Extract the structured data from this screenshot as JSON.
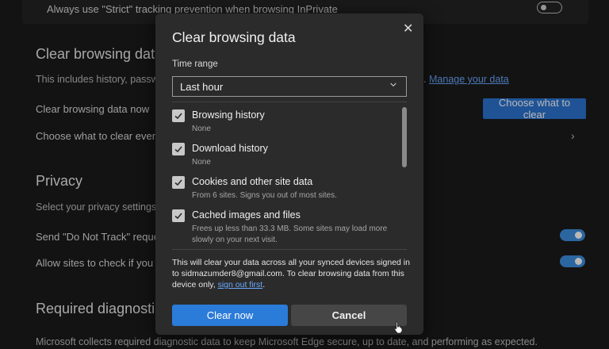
{
  "background": {
    "strict_toggle_text": "Always use \"Strict\" tracking prevention when browsing InPrivate",
    "clear_section_title": "Clear browsing data",
    "clear_section_desc": "This includes history, passwo",
    "manage_link_dot": ".",
    "manage_link": "Manage your data",
    "clear_now_row": "Clear browsing data now",
    "choose_button": "Choose what to clear",
    "choose_every_row": "Choose what to clear every t",
    "privacy_title": "Privacy",
    "privacy_desc": "Select your privacy settings fo",
    "dnt_row": "Send \"Do Not Track\" reques",
    "allow_sites_row": "Allow sites to check if you ha",
    "required_diag_title": "Required diagnostic",
    "footer_text": "Microsoft collects required diagnostic data to keep Microsoft Edge secure, up to date, and performing as expected."
  },
  "dialog": {
    "title": "Clear browsing data",
    "close_icon": "close-icon",
    "time_range_label": "Time range",
    "time_range_value": "Last hour",
    "items": [
      {
        "label": "Browsing history",
        "desc": "None",
        "checked": true
      },
      {
        "label": "Download history",
        "desc": "None",
        "checked": true
      },
      {
        "label": "Cookies and other site data",
        "desc": "From 6 sites. Signs you out of most sites.",
        "checked": true
      },
      {
        "label": "Cached images and files",
        "desc": "Frees up less than 33.3 MB. Some sites may load more slowly on your next visit.",
        "checked": true
      }
    ],
    "info_text": "This will clear your data across all your synced devices signed in to sidmazumder8@gmail.com. To clear browsing data from this device only,",
    "sign_out_link": "sign out first",
    "info_period": ".",
    "clear_now_button": "Clear now",
    "cancel_button": "Cancel"
  },
  "colors": {
    "accent": "#2b7bd8",
    "toggle_on": "#3c8ee0",
    "link": "#6aa9ff"
  }
}
